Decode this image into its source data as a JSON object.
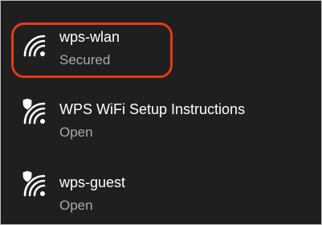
{
  "networks": [
    {
      "name": "wps-wlan",
      "status": "Secured",
      "icon": "wifi-signal-icon",
      "highlighted": true
    },
    {
      "name": "WPS WiFi Setup Instructions",
      "status": "Open",
      "icon": "wifi-open-shield-icon"
    },
    {
      "name": "wps-guest",
      "status": "Open",
      "icon": "wifi-open-shield-icon"
    }
  ],
  "colors": {
    "background": "#1f1f1f",
    "text_primary": "#ffffff",
    "text_secondary": "#a9a9a9",
    "highlight": "#e23b14"
  }
}
